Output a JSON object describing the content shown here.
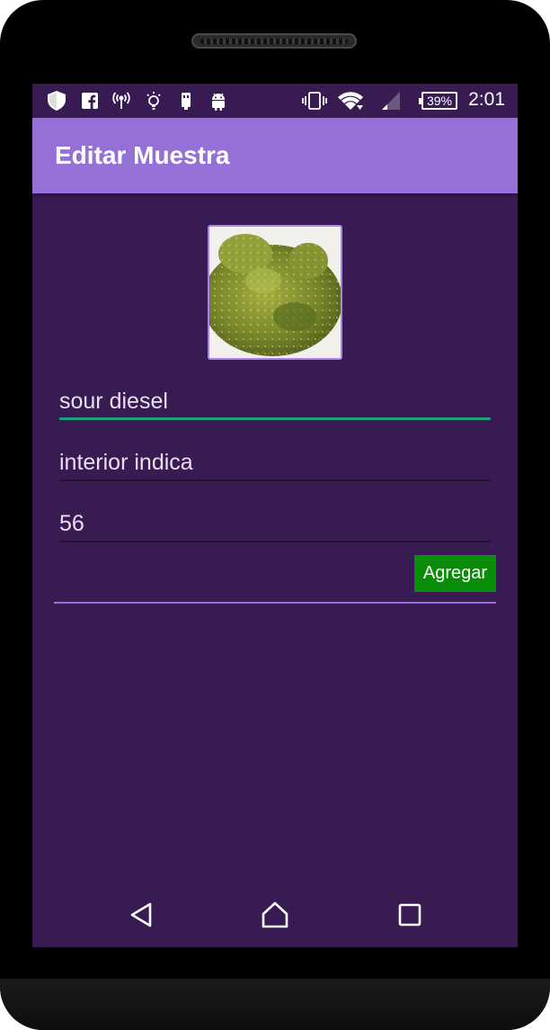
{
  "status_bar": {
    "time": "2:01",
    "battery": "39%",
    "icons": [
      "shield-icon",
      "facebook-icon",
      "antenna-icon",
      "lightbulb-icon",
      "usb-icon",
      "android-icon",
      "vibrate-icon",
      "wifi-icon",
      "signal-icon",
      "battery-icon"
    ]
  },
  "app_bar": {
    "title": "Editar Muestra"
  },
  "sample": {
    "photo": "cannabis-bud-photo",
    "name": "sour diesel",
    "type": "interior indica",
    "quantity": "56"
  },
  "actions": {
    "add_label": "Agregar"
  },
  "nav": {
    "buttons": [
      "back-icon",
      "home-icon",
      "recents-icon"
    ]
  },
  "colors": {
    "background": "#371b52",
    "app_bar": "#9570d7",
    "accent": "#1ca07a",
    "button": "#0a8e0a"
  }
}
